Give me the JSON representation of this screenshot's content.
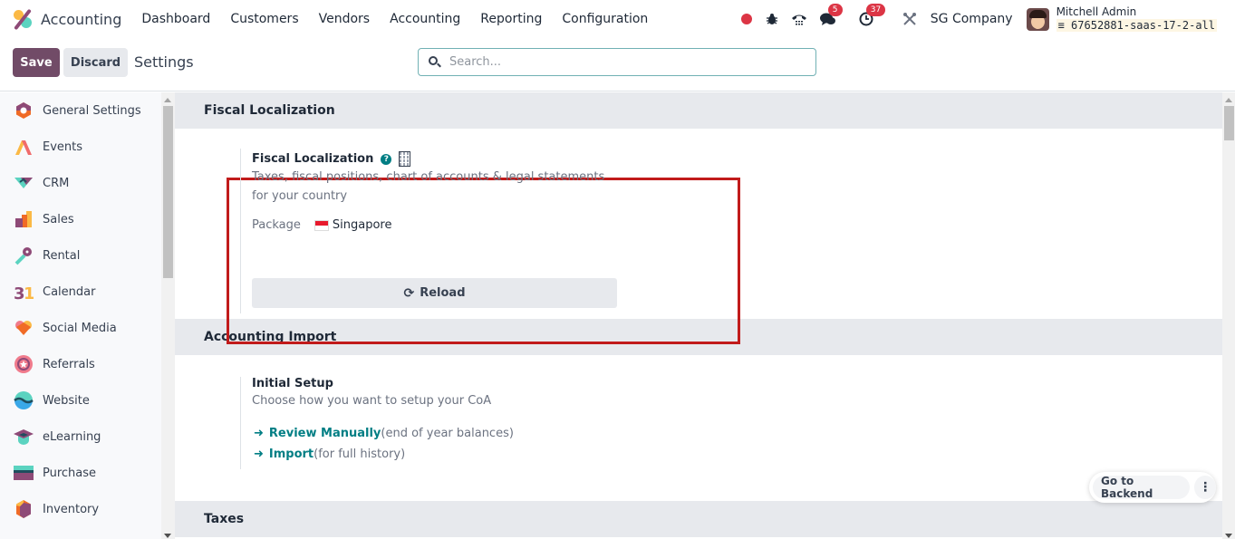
{
  "navbar": {
    "app_name": "Accounting",
    "menu": [
      "Dashboard",
      "Customers",
      "Vendors",
      "Accounting",
      "Reporting",
      "Configuration"
    ],
    "systray": {
      "messages_count": "5",
      "activities_count": "37",
      "company": "SG Company",
      "user_name": "Mitchell Admin",
      "database": "67652881-saas-17-2-all"
    }
  },
  "control_panel": {
    "save_label": "Save",
    "discard_label": "Discard",
    "title": "Settings",
    "search_placeholder": "Search..."
  },
  "sidebar": {
    "items": [
      {
        "label": "General Settings",
        "icon": "general-settings-icon"
      },
      {
        "label": "Events",
        "icon": "events-icon"
      },
      {
        "label": "CRM",
        "icon": "crm-icon"
      },
      {
        "label": "Sales",
        "icon": "sales-icon"
      },
      {
        "label": "Rental",
        "icon": "rental-icon"
      },
      {
        "label": "Calendar",
        "icon": "calendar-icon"
      },
      {
        "label": "Social Media",
        "icon": "social-media-icon"
      },
      {
        "label": "Referrals",
        "icon": "referrals-icon"
      },
      {
        "label": "Website",
        "icon": "website-icon"
      },
      {
        "label": "eLearning",
        "icon": "elearning-icon"
      },
      {
        "label": "Purchase",
        "icon": "purchase-icon"
      },
      {
        "label": "Inventory",
        "icon": "inventory-icon"
      }
    ]
  },
  "sections": {
    "fiscal": {
      "heading": "Fiscal Localization",
      "title": "Fiscal Localization",
      "description": "Taxes, fiscal positions, chart of accounts & legal statements for your country",
      "package_label": "Package",
      "package_value": "Singapore",
      "reload_label": "Reload",
      "highlight_color": "#c11b1b"
    },
    "import": {
      "heading": "Accounting Import",
      "title": "Initial Setup",
      "description": "Choose how you want to setup your CoA",
      "links": [
        {
          "label": "Review Manually",
          "note": "(end of year balances)"
        },
        {
          "label": "Import",
          "note": "(for full history)"
        }
      ]
    },
    "taxes": {
      "heading": "Taxes"
    }
  },
  "floating": {
    "backend_label": "Go to Backend",
    "more_icon": "⋮"
  },
  "colors": {
    "primary": "#714b67",
    "link": "#017e84",
    "badge": "#dc3545"
  }
}
